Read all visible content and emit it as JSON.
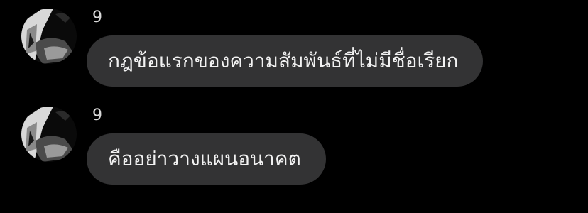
{
  "messages": [
    {
      "sender": "9",
      "avatar_icon": "user-photo-avatar",
      "text": "กฎข้อแรกของความสัมพันธ์ที่ไม่มีชื่อเรียก"
    },
    {
      "sender": "9",
      "avatar_icon": "user-photo-avatar",
      "text": "คืออย่าวางแผนอนาคต"
    }
  ],
  "colors": {
    "background": "#000000",
    "bubble": "#333334",
    "bubble_text": "#f2f2f2",
    "sender_text": "#d9d9d9"
  }
}
